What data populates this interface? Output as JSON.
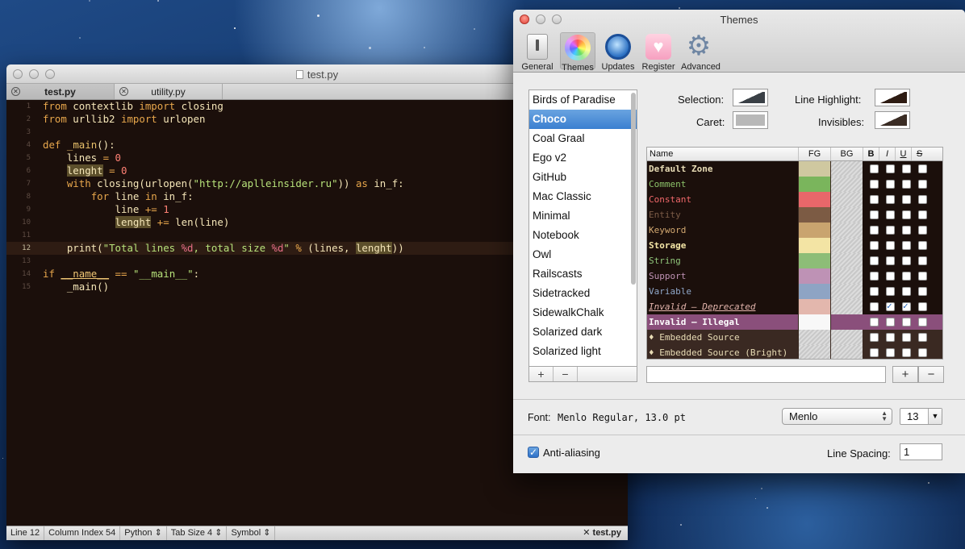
{
  "editor": {
    "title": "test.py",
    "tabs": [
      {
        "label": "test.py",
        "active": true
      },
      {
        "label": "utility.py",
        "active": false
      }
    ],
    "lines": [
      {
        "n": "1",
        "t": "from contextlib import closing"
      },
      {
        "n": "2",
        "t": "from urllib2 import urlopen"
      },
      {
        "n": "3",
        "t": ""
      },
      {
        "n": "4",
        "t": "def _main():"
      },
      {
        "n": "5",
        "t": "    lines = 0"
      },
      {
        "n": "6",
        "t": "    lenght = 0"
      },
      {
        "n": "7",
        "t": "    with closing(urlopen(\"http://aplleinsider.ru\")) as in_f:"
      },
      {
        "n": "8",
        "t": "        for line in in_f:"
      },
      {
        "n": "9",
        "t": "            line += 1"
      },
      {
        "n": "10",
        "t": "            lenght += len(line)"
      },
      {
        "n": "11",
        "t": ""
      },
      {
        "n": "12",
        "t": "    print(\"Total lines %d, total size %d\" % (lines, lenght))"
      },
      {
        "n": "13",
        "t": ""
      },
      {
        "n": "14",
        "t": "if __name__ == \"__main__\":"
      },
      {
        "n": "15",
        "t": "    _main()"
      }
    ],
    "current_line": "12",
    "status": {
      "line": "Line 12",
      "column": "Column Index 54",
      "syntax": "Python",
      "tab_size": "Tab Size 4",
      "symbol": "Symbol",
      "file": "test.py"
    }
  },
  "themes_window": {
    "title": "Themes",
    "toolbar": [
      {
        "label": "General",
        "icon": "switch-icon"
      },
      {
        "label": "Themes",
        "icon": "color-wheel-icon",
        "selected": true
      },
      {
        "label": "Updates",
        "icon": "refresh-globe-icon"
      },
      {
        "label": "Register",
        "icon": "heart-icon"
      },
      {
        "label": "Advanced",
        "icon": "gear-icon"
      }
    ],
    "theme_list": [
      "Birds of Paradise",
      "Choco",
      "Coal Graal",
      "Ego v2",
      "GitHub",
      "Mac Classic",
      "Minimal",
      "Notebook",
      "Owl",
      "Railscasts",
      "Sidetracked",
      "SidewalkChalk",
      "Solarized dark",
      "Solarized light"
    ],
    "selected_theme": "Choco",
    "list_buttons": {
      "add": "+",
      "remove": "−"
    },
    "labels": {
      "selection": "Selection:",
      "caret": "Caret:",
      "line_highlight": "Line Highlight:",
      "invisibles": "Invisibles:"
    },
    "grid_headers": {
      "name": "Name",
      "fg": "FG",
      "bg": "BG",
      "b": "B",
      "i": "I",
      "u": "U",
      "s": "S"
    },
    "scopes": [
      {
        "name": "Default Zone",
        "color": "#e8dcb5",
        "fg": "#cfc8a0",
        "bg": "",
        "i": false,
        "u": false
      },
      {
        "name": "Comment",
        "color": "#8cc36a",
        "fg": "#7ab55c",
        "bg": "",
        "i": false,
        "u": false
      },
      {
        "name": "Constant",
        "color": "#f0686a",
        "fg": "#e8676a",
        "bg": "",
        "i": false,
        "u": false
      },
      {
        "name": "Entity",
        "color": "#7c5c47",
        "fg": "#7c5b44",
        "bg": "",
        "i": false,
        "u": false
      },
      {
        "name": "Keyword",
        "color": "#d3a870",
        "fg": "#c9a46f",
        "bg": "",
        "i": false,
        "u": false
      },
      {
        "name": "Storage",
        "color": "#f4e6a6",
        "fg": "#f3e4a4",
        "bg": "",
        "i": false,
        "u": false
      },
      {
        "name": "String",
        "color": "#8fc57a",
        "fg": "#8dbd77",
        "bg": "",
        "i": false,
        "u": false
      },
      {
        "name": "Support",
        "color": "#c093b5",
        "fg": "#be92b5",
        "bg": "",
        "i": false,
        "u": false
      },
      {
        "name": "Variable",
        "color": "#8fa7c9",
        "fg": "#8ea4c4",
        "bg": "",
        "i": false,
        "u": false
      },
      {
        "name": "Invalid — Deprecated",
        "color": "#e4b5ad",
        "fg": "#e3b7ad",
        "bg": "",
        "i": true,
        "u": true
      },
      {
        "name": "Invalid — Illegal",
        "color": "#ffffff",
        "fg": "#f8f8f8",
        "bg": "#8a4f7b",
        "i": false,
        "u": false
      },
      {
        "name": "♦ Embedded Source",
        "color": "#e8dcb5",
        "fg": "",
        "bg": "",
        "i": false,
        "u": false
      },
      {
        "name": "♦ Embedded Source (Bright)",
        "color": "#e8dcb5",
        "fg": "",
        "bg": "",
        "i": false,
        "u": false
      }
    ],
    "font_label": "Font:",
    "font_value": "Menlo Regular, 13.0 pt",
    "font_family": "Menlo",
    "font_size": "13",
    "anti_aliasing": "Anti-aliasing",
    "line_spacing_label": "Line Spacing:",
    "line_spacing_value": "1"
  },
  "colors": {
    "editor_bg": "#1b0f0b",
    "selection_accent": "#3a7fd0"
  }
}
